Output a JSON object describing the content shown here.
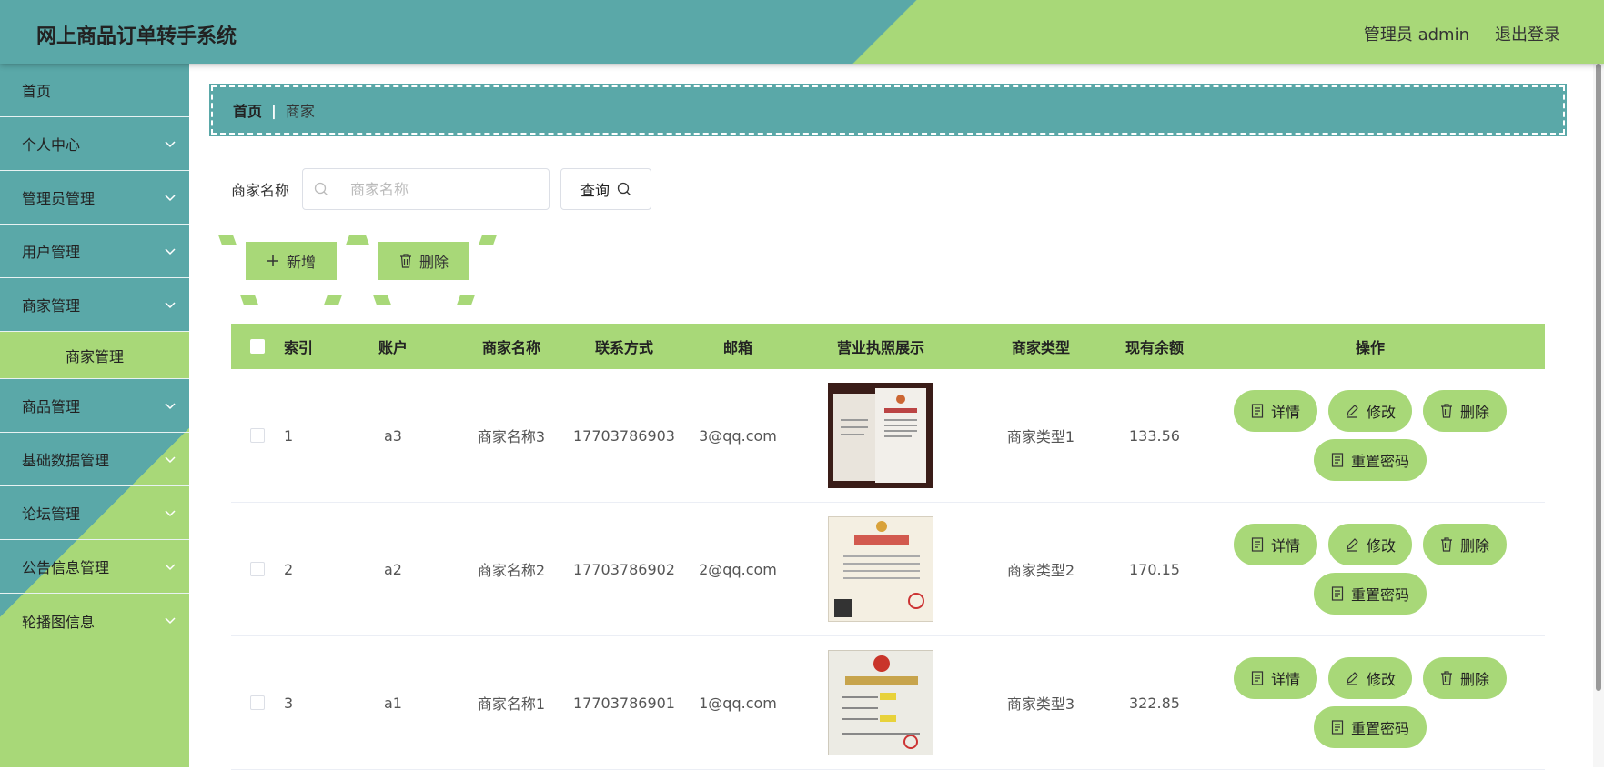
{
  "header": {
    "title": "网上商品订单转手系统",
    "user_label": "管理员 admin",
    "logout_label": "退出登录"
  },
  "sidebar": {
    "items": [
      {
        "label": "首页"
      },
      {
        "label": "个人中心"
      },
      {
        "label": "管理员管理"
      },
      {
        "label": "用户管理"
      },
      {
        "label": "商家管理"
      },
      {
        "label": "商家管理",
        "sub": true
      },
      {
        "label": "商品管理"
      },
      {
        "label": "基础数据管理"
      },
      {
        "label": "论坛管理"
      },
      {
        "label": "公告信息管理"
      },
      {
        "label": "轮播图信息"
      }
    ]
  },
  "breadcrumb": {
    "home": "首页",
    "current": "商家"
  },
  "search": {
    "label": "商家名称",
    "placeholder": "商家名称",
    "query_label": "查询"
  },
  "actions": {
    "add_label": "新增",
    "delete_label": "删除"
  },
  "table": {
    "headers": [
      "索引",
      "账户",
      "商家名称",
      "联系方式",
      "邮箱",
      "营业执照展示",
      "商家类型",
      "现有余额",
      "操作"
    ],
    "rows": [
      {
        "index": "1",
        "account": "a3",
        "name": "商家名称3",
        "phone": "17703786903",
        "email": "3@qq.com",
        "type": "商家类型1",
        "balance": "133.56"
      },
      {
        "index": "2",
        "account": "a2",
        "name": "商家名称2",
        "phone": "17703786902",
        "email": "2@qq.com",
        "type": "商家类型2",
        "balance": "170.15"
      },
      {
        "index": "3",
        "account": "a1",
        "name": "商家名称1",
        "phone": "17703786901",
        "email": "1@qq.com",
        "type": "商家类型3",
        "balance": "322.85"
      }
    ],
    "ops": {
      "detail": "详情",
      "edit": "修改",
      "delete": "删除",
      "reset": "重置密码"
    }
  },
  "colors": {
    "teal": "#5aa8a8",
    "green": "#a8d878"
  }
}
